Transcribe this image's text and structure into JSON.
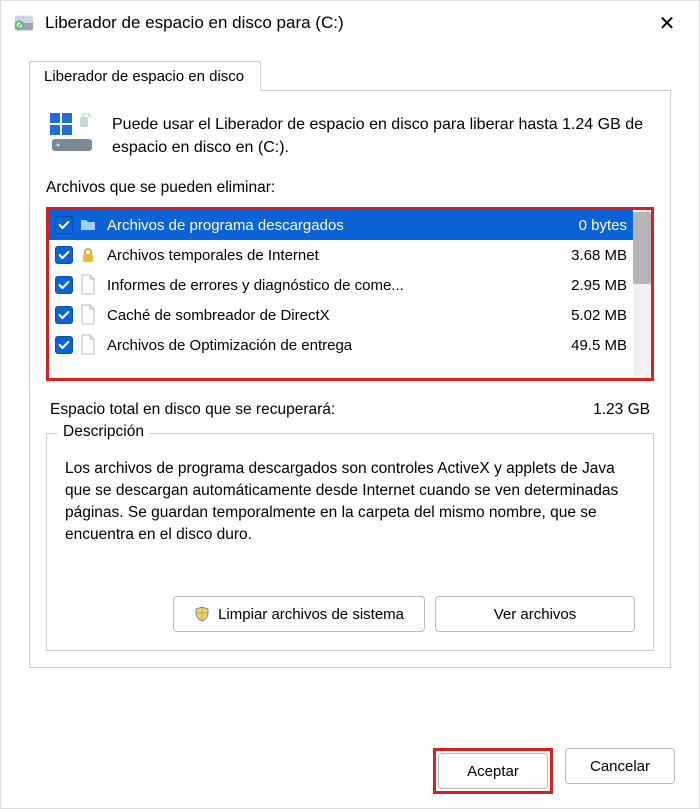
{
  "window": {
    "title": "Liberador de espacio en disco para  (C:)"
  },
  "tab": {
    "label": "Liberador de espacio en disco"
  },
  "intro": "Puede usar el Liberador de espacio en disco para liberar hasta 1.24 GB de espacio en disco en  (C:).",
  "files_section_label": "Archivos que se pueden eliminar:",
  "files": [
    {
      "name": "Archivos de programa descargados",
      "size": "0 bytes",
      "icon": "folder",
      "selected": true
    },
    {
      "name": "Archivos temporales de Internet",
      "size": "3.68 MB",
      "icon": "lock",
      "selected": false
    },
    {
      "name": "Informes de errores y diagnóstico de come...",
      "size": "2.95 MB",
      "icon": "file",
      "selected": false
    },
    {
      "name": "Caché de sombreador de DirectX",
      "size": "5.02 MB",
      "icon": "file",
      "selected": false
    },
    {
      "name": "Archivos de Optimización de entrega",
      "size": "49.5 MB",
      "icon": "file",
      "selected": false
    }
  ],
  "total": {
    "label": "Espacio total en disco que se recuperará:",
    "value": "1.23 GB"
  },
  "description": {
    "heading": "Descripción",
    "text": "Los archivos de programa descargados son controles ActiveX y applets de Java que se descargan automáticamente desde Internet cuando se ven determinadas páginas. Se guardan temporalmente en la carpeta del mismo nombre, que se encuentra en el disco duro."
  },
  "buttons": {
    "clean_system": "Limpiar archivos de sistema",
    "view_files": "Ver archivos",
    "accept": "Aceptar",
    "cancel": "Cancelar"
  }
}
